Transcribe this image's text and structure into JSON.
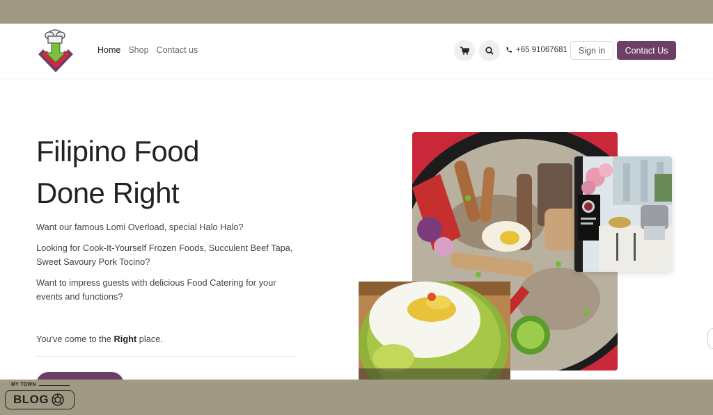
{
  "header": {
    "nav": [
      "Home",
      "Shop",
      "Contact us"
    ],
    "phone": "+65 91067681",
    "signin_label": "Sign in",
    "contact_label": "Contact Us"
  },
  "hero": {
    "title_line1": "Filipino Food",
    "title_line2": "Done Right",
    "para1": "Want our famous Lomi Overload, special Halo Halo?",
    "para2": "Looking for Cook-It-Yourself Frozen Foods, Succulent Beef Tapa, Sweet Savoury Pork Tocino?",
    "para3": "Want to impress guests with delicious Food Catering for your events and functions?",
    "para4_pre": "You've come to the ",
    "para4_bold": "Right",
    "para4_post": " place."
  },
  "badge": {
    "top_text": "MY TOWN",
    "main_text": "BLOG"
  },
  "icons": [
    "logo-chef-icon",
    "cart-icon",
    "search-icon",
    "phone-icon",
    "camera-icon"
  ],
  "colors": {
    "brand": "#6e3f66",
    "frame": "#a09a84",
    "logo_green": "#7ac043",
    "logo_red": "#d7263d"
  }
}
